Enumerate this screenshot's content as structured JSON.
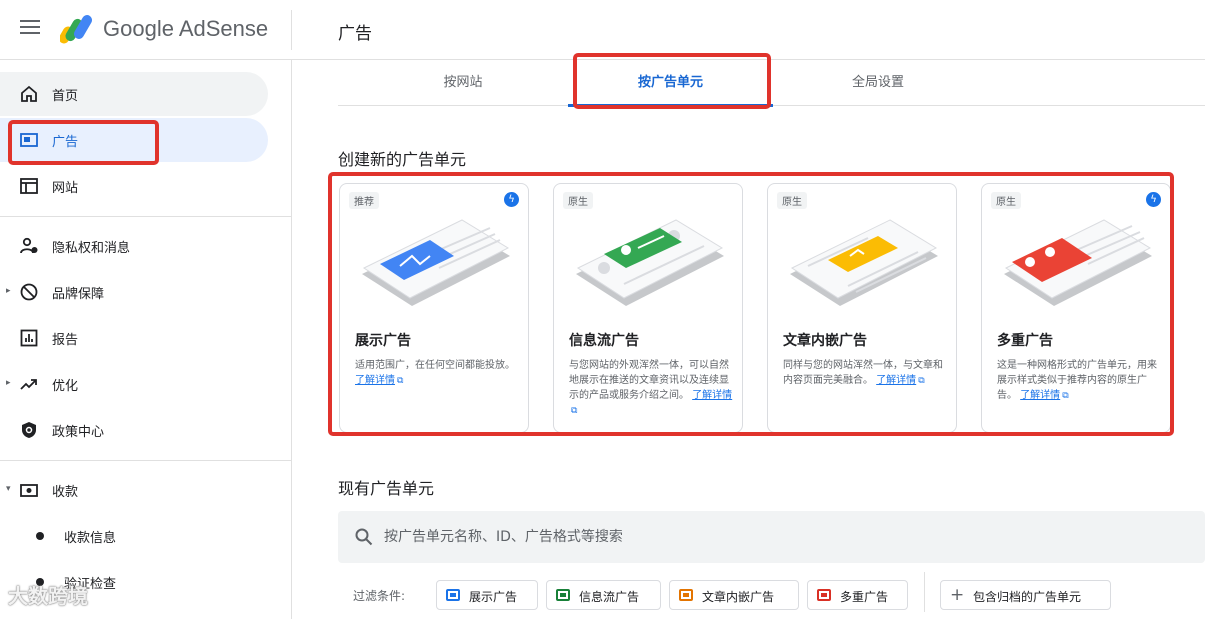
{
  "header": {
    "brand": "Google AdSense",
    "page_title": "广告"
  },
  "sidebar": {
    "items": [
      {
        "label": "首页",
        "icon": "home-icon"
      },
      {
        "label": "广告",
        "icon": "ads-icon"
      },
      {
        "label": "网站",
        "icon": "sites-icon"
      },
      {
        "label": "隐私权和消息",
        "icon": "privacy-icon"
      },
      {
        "label": "品牌保障",
        "icon": "block-icon"
      },
      {
        "label": "报告",
        "icon": "reports-icon"
      },
      {
        "label": "优化",
        "icon": "trending-icon"
      },
      {
        "label": "政策中心",
        "icon": "policy-shield-icon"
      },
      {
        "label": "收款",
        "icon": "payments-icon"
      }
    ],
    "sub_items": [
      {
        "label": "收款信息"
      },
      {
        "label": "验证检查"
      }
    ]
  },
  "tabs": [
    {
      "label": "按网站"
    },
    {
      "label": "按广告单元"
    },
    {
      "label": "全局设置"
    }
  ],
  "create_section": {
    "title": "创建新的广告单元",
    "learn_more": "了解详情",
    "cards": [
      {
        "badge": "推荐",
        "title": "展示广告",
        "desc": "适用范围广，在任何空间都能投放。",
        "accent": "#4285f4"
      },
      {
        "badge": "原生",
        "title": "信息流广告",
        "desc": "与您网站的外观浑然一体，可以自然地展示在推送的文章资讯以及连续显示的产品或服务介绍之间。",
        "accent": "#34a853"
      },
      {
        "badge": "原生",
        "title": "文章内嵌广告",
        "desc": "同样与您的网站浑然一体，与文章和内容页面完美融合。",
        "accent": "#fbbc04"
      },
      {
        "badge": "原生",
        "title": "多重广告",
        "desc": "这是一种网格形式的广告单元，用来展示样式类似于推荐内容的原生广告。",
        "accent": "#ea4335"
      }
    ]
  },
  "existing_section": {
    "title": "现有广告单元",
    "search_placeholder": "按广告单元名称、ID、广告格式等搜索"
  },
  "filters": {
    "label": "过滤条件:",
    "chips": [
      {
        "label": "展示广告",
        "color": "#1a73e8"
      },
      {
        "label": "信息流广告",
        "color": "#188038"
      },
      {
        "label": "文章内嵌广告",
        "color": "#e37400"
      },
      {
        "label": "多重广告",
        "color": "#d93025"
      }
    ],
    "archived_label": "包含归档的广告单元"
  },
  "watermark": "大数跨境"
}
